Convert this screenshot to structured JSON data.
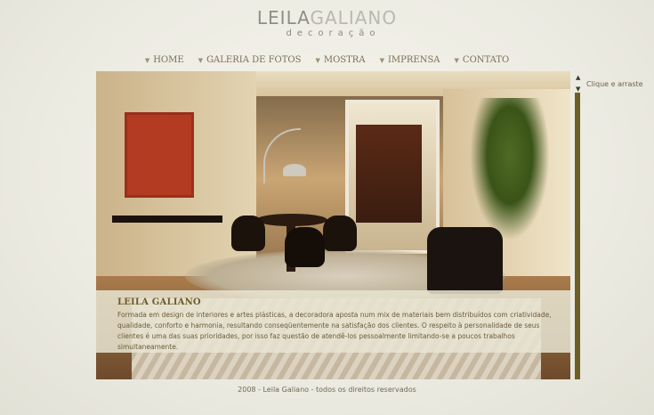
{
  "brand": {
    "name_part1": "LEILA",
    "name_part2": "GALIANO",
    "tagline": "decoração"
  },
  "nav": {
    "items": [
      {
        "label": "HOME"
      },
      {
        "label": "GALERIA DE FOTOS"
      },
      {
        "label": "MOSTRA"
      },
      {
        "label": "IMPRENSA"
      },
      {
        "label": "CONTATO"
      }
    ]
  },
  "content": {
    "title": "LEILA GALIANO",
    "text": "Formada em design de interiores e artes plásticas, a decoradora aposta num mix de materiais bem distribuídos com criatividade, qualidade, conforto e harmonia, resultando conseqüentemente na satisfação dos clientes. O respeito à personalidade de seus clientes é uma das suas prioridades, por isso faz questão de atendê-los pessoalmente limitando-se a poucos trabalhos simultaneamente."
  },
  "scroll": {
    "hint": "Clique e arraste",
    "up_icon": "▲",
    "down_icon": "▼"
  },
  "footer": {
    "text": "2008 - Leila Galiano - todos os direitos reservados"
  },
  "colors": {
    "background": "#ecebe2",
    "nav_text": "#7c6f55",
    "scrollbar": "#6d5e24",
    "caption_title": "#6e5b2a",
    "accent_red": "#b23b22"
  }
}
